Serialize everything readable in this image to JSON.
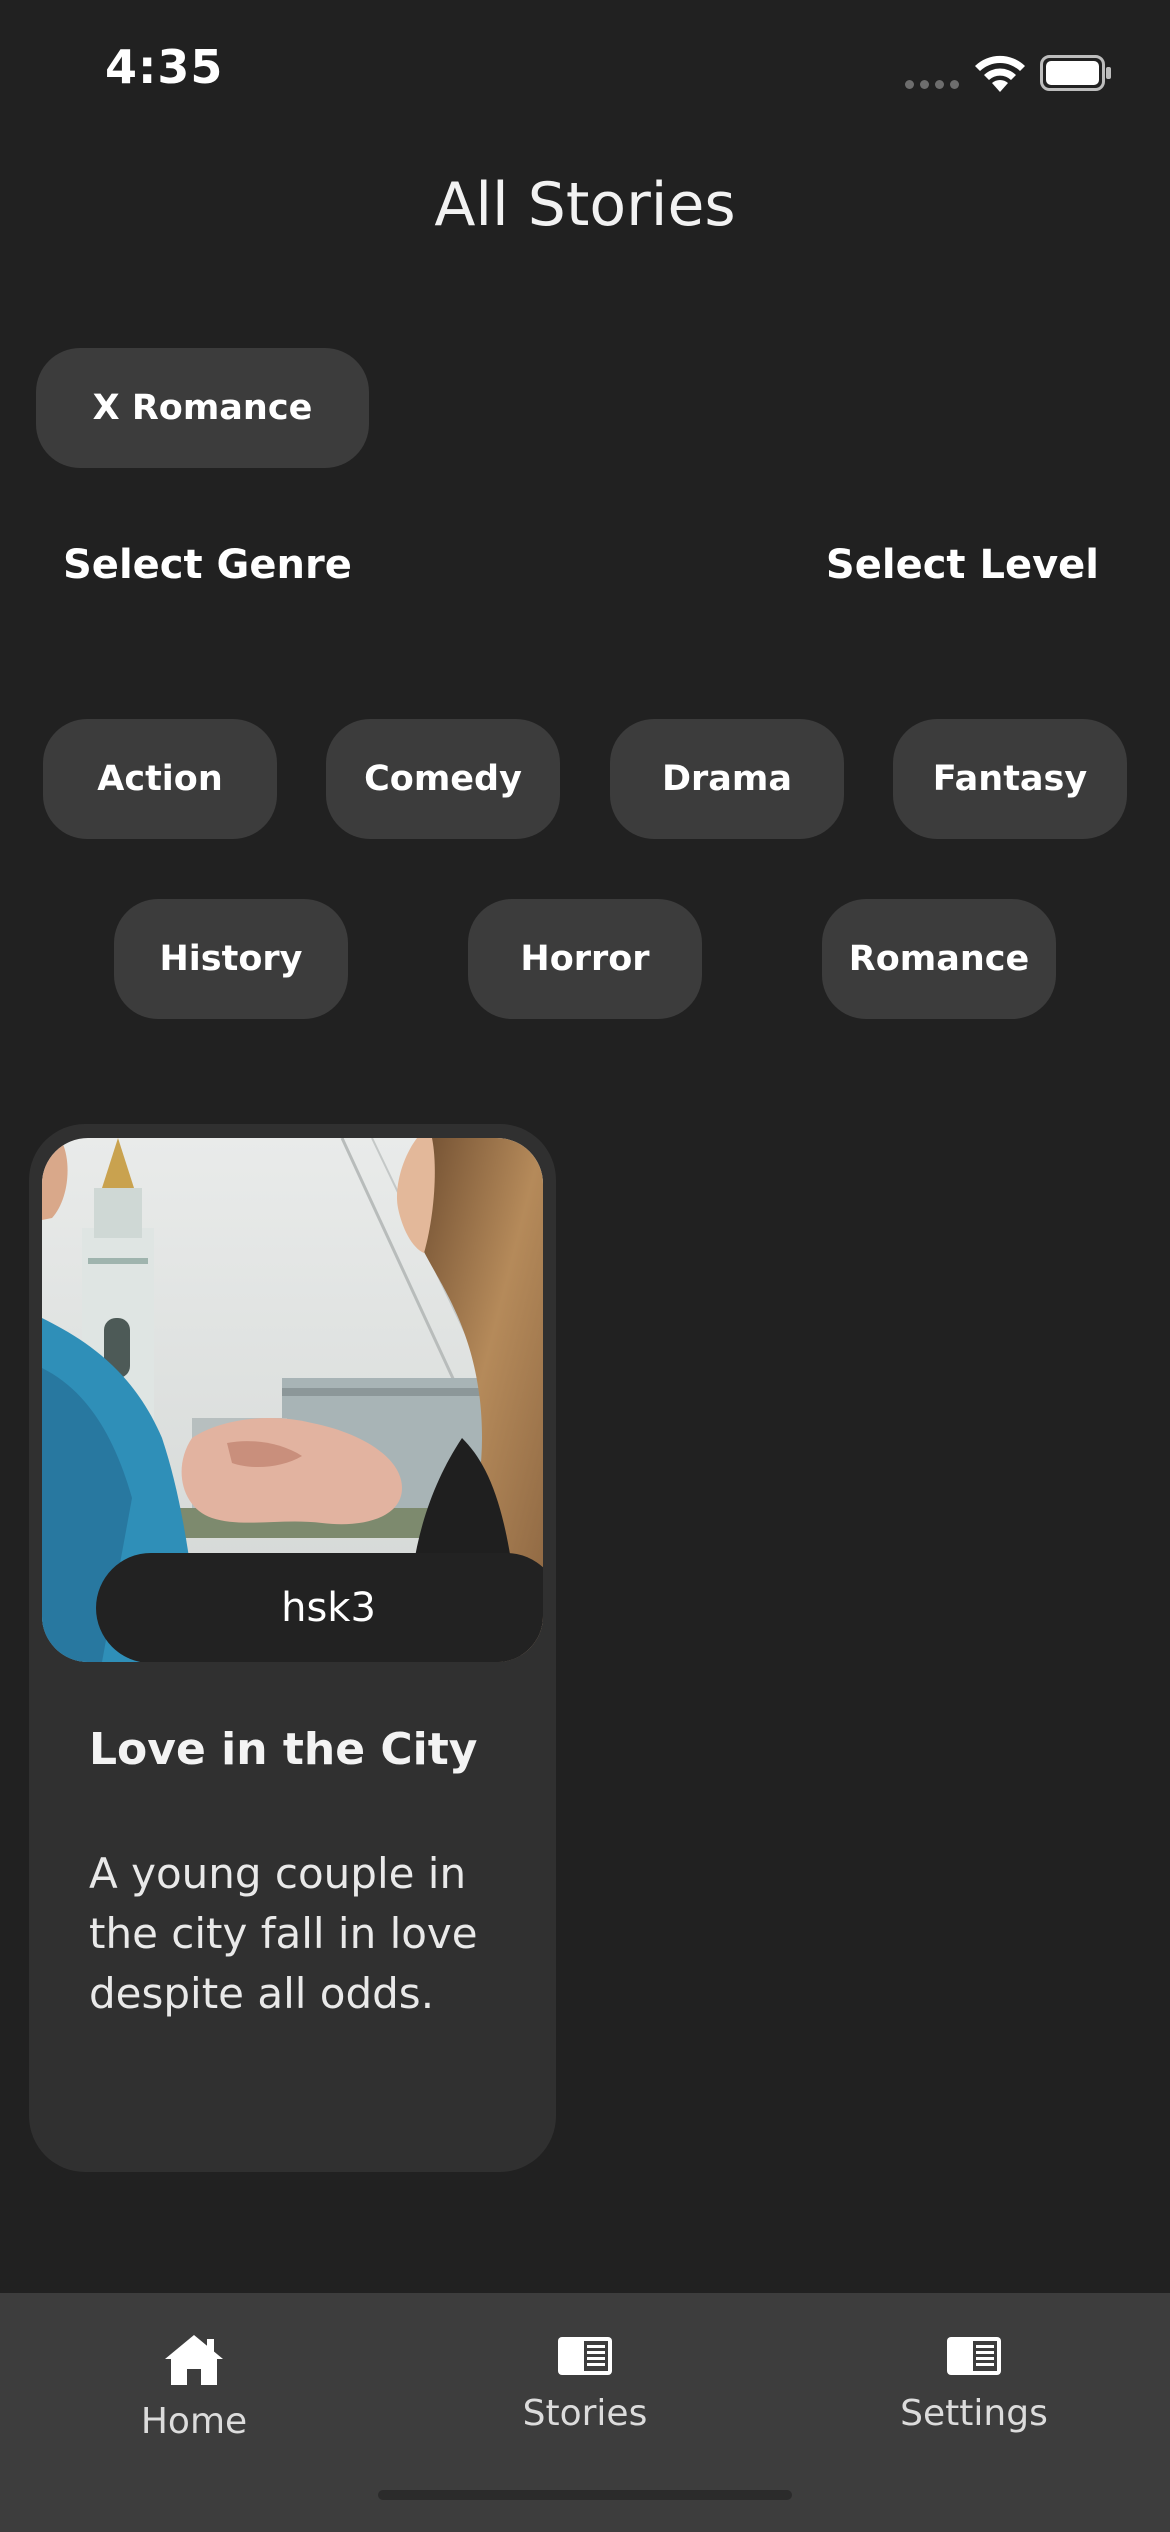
{
  "status_bar": {
    "time": "4:35"
  },
  "header": {
    "title": "All Stories"
  },
  "active_filter": {
    "label": "X  Romance"
  },
  "selectors": {
    "genre_label": "Select Genre",
    "level_label": "Select Level"
  },
  "genres": [
    "Action",
    "Comedy",
    "Drama",
    "Fantasy",
    "History",
    "Horror",
    "Romance"
  ],
  "stories": [
    {
      "level": "hsk3",
      "title": "Love in the City",
      "description": "A young couple in the city fall in love despite all odds."
    }
  ],
  "tabbar": {
    "items": [
      {
        "label": "Home",
        "icon": "home-icon"
      },
      {
        "label": "Stories",
        "icon": "book-icon"
      },
      {
        "label": "Settings",
        "icon": "book-icon"
      }
    ]
  },
  "colors": {
    "background": "#212121",
    "chip": "#3c3c3c",
    "card": "#303030",
    "tabbar": "#3d3d3d"
  }
}
